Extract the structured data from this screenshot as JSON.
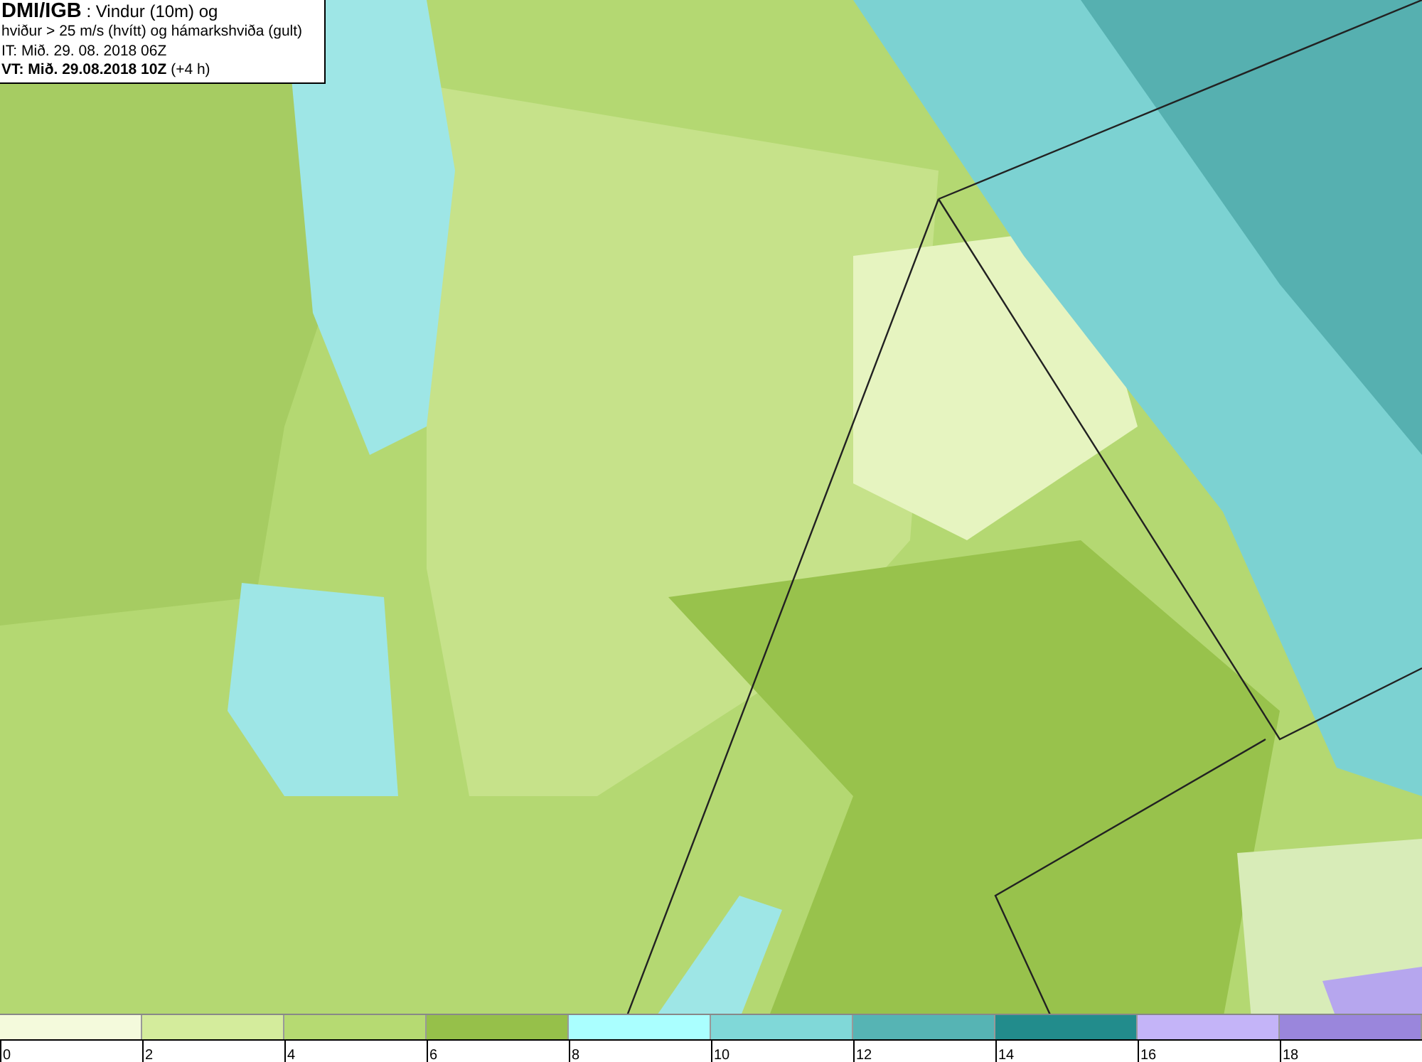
{
  "header": {
    "lines": [
      "**DMI/IGB** : Vindur (10m) og",
      "hviður > 25 m/s (hvítt) og hámarkshviða (gult)",
      "IT: Mið. 29. 08. 2018 06Z",
      "**VT: Mið. 29.08.2018 10Z** (+4 h)"
    ]
  },
  "legend": {
    "bins": [
      {
        "color": "#f4fadc"
      },
      {
        "color": "#d4ec9c"
      },
      {
        "color": "#b6da72"
      },
      {
        "color": "#96c04a"
      },
      {
        "color": "#aaffff"
      },
      {
        "color": "#80d8d8"
      },
      {
        "color": "#56b4b4"
      },
      {
        "color": "#228c8c"
      },
      {
        "color": "#c4b4f8"
      },
      {
        "color": "#9a86dc"
      }
    ],
    "ticks": [
      "0",
      "2",
      "4",
      "6",
      "8",
      "10",
      "12",
      "14",
      "16",
      "18"
    ]
  }
}
